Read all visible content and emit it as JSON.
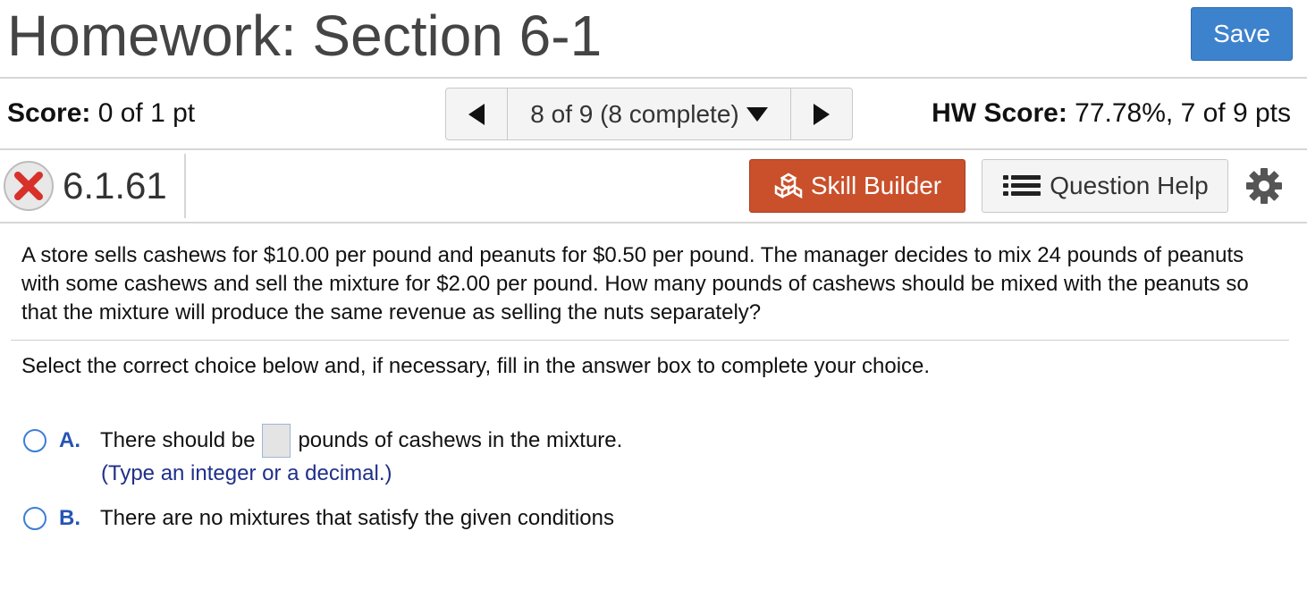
{
  "header": {
    "title": "Homework: Section 6-1",
    "save_label": "Save"
  },
  "status": {
    "score_label": "Score:",
    "score_value": "0 of 1 pt",
    "nav_position": "8 of 9 (8 complete)",
    "hw_score_label": "HW Score:",
    "hw_score_value": "77.78%, 7 of 9 pts"
  },
  "question_bar": {
    "number": "6.1.61",
    "result_icon": "x-icon",
    "skill_builder_label": "Skill Builder",
    "question_help_label": "Question Help"
  },
  "question": {
    "text": "A store sells cashews for $10.00 per pound and peanuts for $0.50 per pound. The manager decides to mix 24 pounds of peanuts with some cashews and sell the mixture for $2.00 per pound. How many pounds of cashews should be mixed with the peanuts so that the mixture will produce the same revenue as selling the nuts separately?",
    "instruction": "Select the correct choice below and, if necessary, fill in the answer box to complete your choice."
  },
  "choices": [
    {
      "letter": "A.",
      "text_before": "There should be",
      "text_after": "pounds of cashews in the mixture.",
      "hint": "(Type an integer or a decimal.)",
      "answer_value": ""
    },
    {
      "letter": "B.",
      "text": "There are no mixtures that satisfy the given conditions"
    }
  ],
  "colors": {
    "save": "#3d82cc",
    "skill_builder": "#c9502b",
    "choice_letter": "#2654b4",
    "hint": "#1f2f8a",
    "wrong": "#d8312a"
  }
}
